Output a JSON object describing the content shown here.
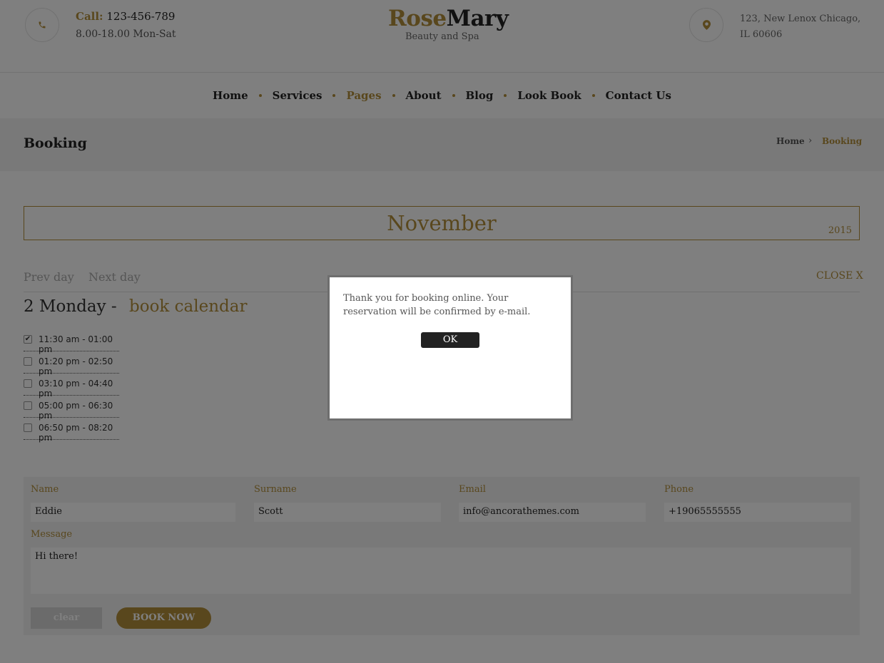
{
  "header": {
    "call_label": "Call:",
    "phone": "123-456-789",
    "hours": "8.00-18.00 Mon-Sat",
    "logo_part1": "Rose",
    "logo_part2": "Mary",
    "tagline": "Beauty and Spa",
    "address_line1": "123, New Lenox Chicago,",
    "address_line2": "IL 60606",
    "phone_icon": "phone-icon",
    "location_icon": "map-pin-icon"
  },
  "nav": {
    "items": [
      {
        "label": "Home",
        "active": false
      },
      {
        "label": "Services",
        "active": false
      },
      {
        "label": "Pages",
        "active": true
      },
      {
        "label": "About",
        "active": false
      },
      {
        "label": "Blog",
        "active": false
      },
      {
        "label": "Look Book",
        "active": false
      },
      {
        "label": "Contact Us",
        "active": false
      }
    ]
  },
  "breadcrumb": {
    "title": "Booking",
    "home": "Home",
    "separator": "›",
    "current": "Booking"
  },
  "calendar": {
    "month": "November",
    "year": "2015",
    "prev": "Prev day",
    "next": "Next day",
    "close": "CLOSE",
    "close_x": "X",
    "day_number": "2",
    "day_name": "Monday",
    "dash": "-",
    "link_book": "book",
    "link_calendar": "calendar",
    "slots": [
      {
        "time": "11:30 am - 01:00 pm",
        "checked": true
      },
      {
        "time": "01:20 pm - 02:50 pm",
        "checked": false
      },
      {
        "time": "03:10 pm - 04:40 pm",
        "checked": false
      },
      {
        "time": "05:00 pm - 06:30 pm",
        "checked": false
      },
      {
        "time": "06:50 pm - 08:20 pm",
        "checked": false
      }
    ]
  },
  "form": {
    "name_label": "Name",
    "name_value": "Eddie",
    "surname_label": "Surname",
    "surname_value": "Scott",
    "email_label": "Email",
    "email_value": "info@ancorathemes.com",
    "phone_label": "Phone",
    "phone_value": "+19065555555",
    "message_label": "Message",
    "message_value": "Hi there!",
    "clear_button": "clear",
    "book_button": "BOOK NOW"
  },
  "dialog": {
    "message": "Thank you for booking online. Your reservation will be confirmed by e-mail.",
    "ok_button": "OK"
  },
  "colors": {
    "accent": "#b38f3a",
    "overlay": "rgba(0,0,0,0.5)"
  }
}
